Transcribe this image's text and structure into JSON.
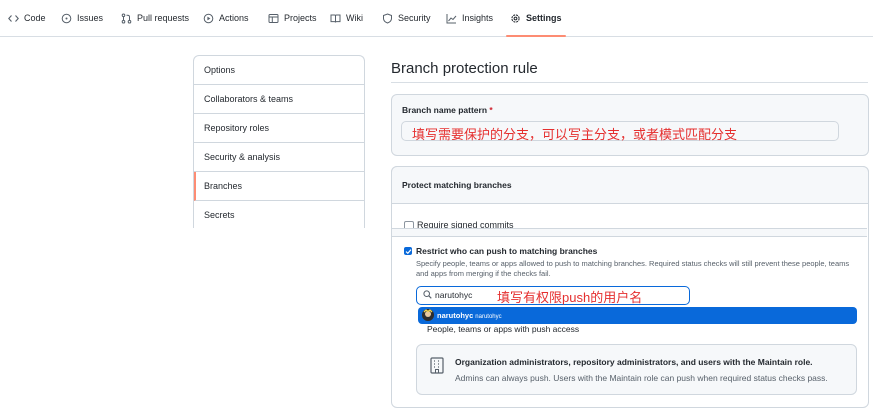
{
  "nav": {
    "tabs": [
      {
        "label": "Code",
        "icon": "code-icon"
      },
      {
        "label": "Issues",
        "icon": "issue-opened-icon"
      },
      {
        "label": "Pull requests",
        "icon": "git-pull-request-icon"
      },
      {
        "label": "Actions",
        "icon": "play-icon"
      },
      {
        "label": "Projects",
        "icon": "table-icon"
      },
      {
        "label": "Wiki",
        "icon": "book-icon"
      },
      {
        "label": "Security",
        "icon": "shield-icon"
      },
      {
        "label": "Insights",
        "icon": "graph-icon"
      },
      {
        "label": "Settings",
        "icon": "gear-icon"
      }
    ],
    "active": "Settings"
  },
  "sidebar": {
    "items": [
      {
        "label": "Options"
      },
      {
        "label": "Collaborators & teams"
      },
      {
        "label": "Repository roles"
      },
      {
        "label": "Security & analysis"
      },
      {
        "label": "Branches"
      },
      {
        "label": "Secrets"
      }
    ],
    "selected": "Branches"
  },
  "main": {
    "title": "Branch protection rule",
    "pattern": {
      "label": "Branch name pattern",
      "required_mark": "*",
      "annotation": "填写需要保护的分支，可以写主分支，或者模式匹配分支"
    },
    "protect": {
      "title": "Protect matching branches",
      "cut_option": "Require signed commits",
      "restrict": {
        "label": "Restrict who can push to matching branches",
        "description": "Specify people, teams or apps allowed to push to matching branches. Required status checks will still prevent these people, teams and apps from merging if the checks fail.",
        "search_value": "narutohyc",
        "annotation": "填写有权限push的用户名",
        "dropdown": {
          "user": "narutohyc",
          "login": "narutohyc"
        },
        "access_label": "People, teams or apps with push access",
        "org_title": "Organization administrators, repository administrators, and users with the Maintain role.",
        "org_desc": "Admins can always push. Users with the Maintain role can push when required status checks pass."
      }
    }
  },
  "colors": {
    "accent": "#0969da",
    "tab_underline": "#fd8c73",
    "annotation": "#e52f2f"
  }
}
